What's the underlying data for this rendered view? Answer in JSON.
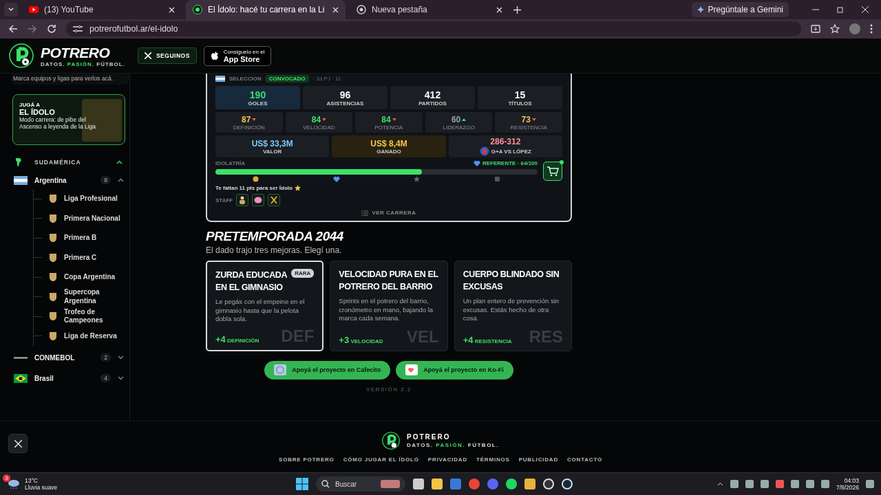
{
  "browser": {
    "tabs": [
      {
        "kind": "video",
        "title": "(13) YouTube",
        "selected": false
      },
      {
        "kind": "site",
        "title": "El Ídolo: hacé tu carrera en la Li",
        "selected": true
      },
      {
        "kind": "newtab",
        "title": "Nueva pestaña",
        "selected": false
      }
    ],
    "gemini": "Pregúntale a Gemini",
    "url": "potrerofutbol.ar/el-idolo"
  },
  "header": {
    "brand": "POTRERO",
    "tagline": [
      {
        "text": "DATOS.",
        "highlight": false
      },
      {
        "text": "PASIÓN.",
        "highlight": true
      },
      {
        "text": "FÚTBOL.",
        "highlight": false
      }
    ],
    "follow": "SEGUINOS",
    "store_kicker": "Consiguelo en el",
    "store": "App Store"
  },
  "sidebar": {
    "note": "Marca equipos y ligas para verlos acá.",
    "promo": {
      "kicker": "JUGÁ A",
      "title": "EL ÍDOLO",
      "text": "Modo carrera: de pibe del Ascenso a leyenda de la Liga"
    },
    "region": {
      "name": "SUDAMÉRICA",
      "expanded": true
    },
    "countries": [
      {
        "kind": "argentina",
        "name": "Argentina",
        "count": "8",
        "expanded": true,
        "children": [
          {
            "name": "Liga Profesional"
          },
          {
            "name": "Primera Nacional"
          },
          {
            "name": "Primera B"
          },
          {
            "name": "Primera C"
          },
          {
            "name": "Copa Argentina"
          },
          {
            "name": "Supercopa Argentina"
          },
          {
            "name": "Trofeo de Campeones"
          },
          {
            "name": "Liga de Reserva"
          }
        ]
      },
      {
        "kind": "conmebol",
        "name": "CONMEBOL",
        "count": "2",
        "expanded": false
      },
      {
        "kind": "brasil",
        "name": "Brasil",
        "count": "4",
        "expanded": false
      }
    ]
  },
  "career": {
    "selection": {
      "label": "SELECCION",
      "badge": "CONVOCADO",
      "meta": "· 33 PJ · 11"
    },
    "totals": [
      {
        "value": "190",
        "label": "GOLES",
        "highlighted": true
      },
      {
        "value": "96",
        "label": "ASISTENCIAS",
        "highlighted": false
      },
      {
        "value": "412",
        "label": "PARTIDOS",
        "highlighted": false
      },
      {
        "value": "15",
        "label": "TÍTULOS",
        "highlighted": false
      }
    ],
    "attributes": [
      {
        "value": "87",
        "label": "DEFINICIÓN",
        "rising": false,
        "color": "#f5c451"
      },
      {
        "value": "84",
        "label": "VELOCIDAD",
        "rising": false,
        "color": "#3ee06a"
      },
      {
        "value": "84",
        "label": "POTENCIA",
        "rising": false,
        "color": "#3ee06a"
      },
      {
        "value": "60",
        "label": "LIDERAZGO",
        "rising": true,
        "color": "#9aa3ad"
      },
      {
        "value": "73",
        "label": "RESISTENCIA",
        "rising": false,
        "color": "#f5c451"
      }
    ],
    "money": [
      {
        "kind": "value",
        "value": "US$ 33,3M",
        "label": "VALOR"
      },
      {
        "kind": "earned",
        "value": "US$ 8,4M",
        "label": "GANADO"
      },
      {
        "kind": "rival",
        "value": "286-312",
        "label": "G+A VS LÓPEZ"
      }
    ],
    "idolatry": {
      "label": "IDOLATRÍA",
      "status": "REFERENTE · 64/100",
      "level": 0.64,
      "hint": "Te faltan 11 pts para ser Ídolo"
    },
    "staff_label": "STAFF",
    "more": "VER CARRERA"
  },
  "preseason": {
    "title": "PRETEMPORADA 2044",
    "subtitle": "El dado trajo tres mejoras. Elegí una.",
    "options": [
      {
        "title": "ZURDA EDUCADA EN EL GIMNASIO",
        "rarity": "RARA",
        "description": "Le pegás con el empeine en el gimnasio hasta que la pelota dobla sola.",
        "bonus": "+4",
        "stat": "DEFINICIÓN",
        "watermark": "DEF",
        "selected": true
      },
      {
        "title": "VELOCIDAD PURA EN EL POTRERO DEL BARRIO",
        "description": "Sprints en el potrero del barrio, cronómetro en mano, bajando la marca cada semana.",
        "bonus": "+3",
        "stat": "VELOCIDAD",
        "watermark": "VEL",
        "selected": false
      },
      {
        "title": "CUERPO BLINDADO SIN EXCUSAS",
        "description": "Un plan entero de prevención sin excusas. Estás hecho de otra cosa.",
        "bonus": "+4",
        "stat": "RESISTENCIA",
        "watermark": "RES",
        "selected": false
      }
    ]
  },
  "support": [
    {
      "kind": "cafecito",
      "label": "Apoyá el proyecto en Cafecito"
    },
    {
      "kind": "kofi",
      "label": "Apoyá el proyecto en Ko-Fi"
    }
  ],
  "version": "VERSIÓN 2.2",
  "footer": {
    "brand": "POTRERO",
    "tagline": [
      {
        "text": "DATOS.",
        "highlight": false
      },
      {
        "text": "PASIÓN.",
        "highlight": true
      },
      {
        "text": "FÚTBOL.",
        "highlight": false
      }
    ],
    "links": [
      "SOBRE POTRERO",
      "CÓMO JUGAR EL ÍDOLO",
      "PRIVACIDAD",
      "TÉRMINOS",
      "PUBLICIDAD",
      "CONTACTO"
    ]
  },
  "taskbar": {
    "weather_badge": "3",
    "temperature": "13°C",
    "weather": "Lluvia suave",
    "search": "Buscar",
    "time": "04:03",
    "date": "7/8/2026"
  }
}
